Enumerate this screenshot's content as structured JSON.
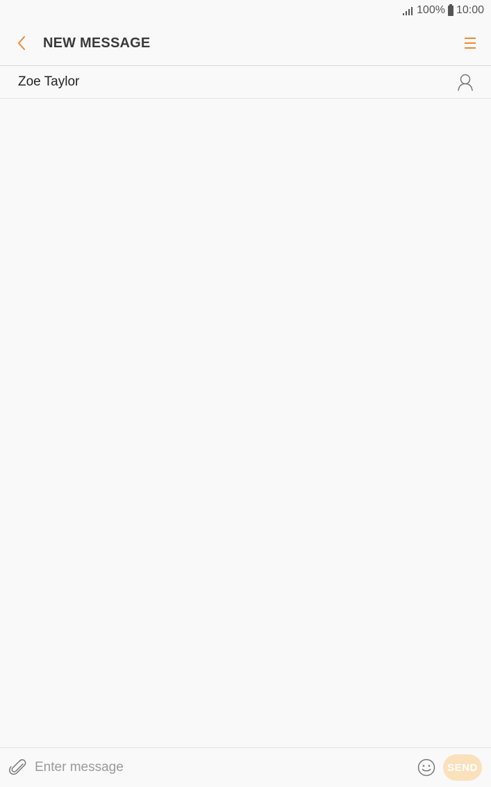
{
  "status_bar": {
    "battery": "100%",
    "time": "10:00",
    "icons": [
      "signal-icon",
      "battery-icon"
    ]
  },
  "app_bar": {
    "title": "NEW MESSAGE",
    "back_icon": "chevron-left-icon",
    "menu_icon": "menu-icon"
  },
  "recipient": {
    "name": "Zoe Taylor",
    "contact_icon": "person-icon"
  },
  "composer": {
    "placeholder": "Enter message",
    "value": "",
    "send_label": "SEND",
    "attach_icon": "paperclip-icon",
    "emoji_icon": "smiley-icon"
  },
  "colors": {
    "accent": "#f0892c",
    "send_disabled_bg": "#fbe0bc",
    "background": "#f9f9f9",
    "title_text": "#3a3a3a"
  }
}
